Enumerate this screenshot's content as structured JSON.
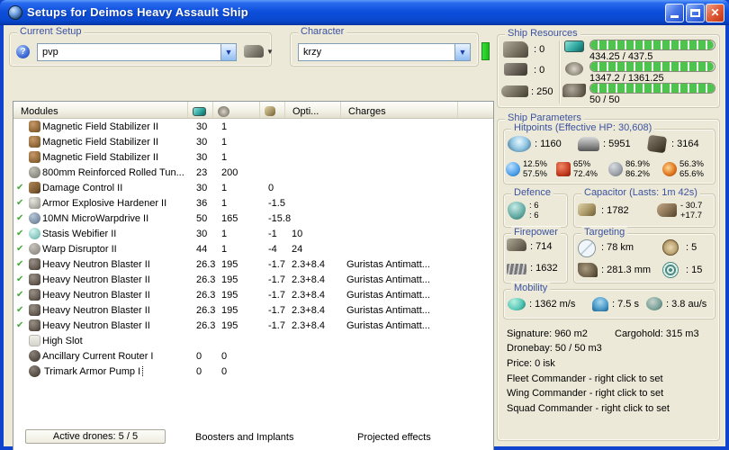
{
  "window": {
    "title": "Setups for Deimos Heavy Assault Ship"
  },
  "colors": {
    "titlebar_blue": "#0D4FDC",
    "body_beige": "#ECE9D8",
    "active_check_green": "#44A838",
    "resource_bar_green": "#4EC44E",
    "character_indicator_green": "#2FD52F",
    "group_label_blue": "#3B52A0"
  },
  "header": {
    "current_setup": {
      "label": "Current Setup",
      "value": "pvp"
    },
    "character": {
      "label": "Character",
      "value": "krzy"
    }
  },
  "modules_table": {
    "active_glyph": "✔",
    "columns": {
      "modules": "Modules",
      "opti": "Opti...",
      "charges": "Charges"
    },
    "rows": [
      {
        "active": false,
        "icon": "magstab",
        "name": "Magnetic Field Stabilizer II",
        "cpu": "30",
        "pg": "1",
        "cap": "",
        "opti": "",
        "charges": ""
      },
      {
        "active": false,
        "icon": "magstab",
        "name": "Magnetic Field Stabilizer II",
        "cpu": "30",
        "pg": "1",
        "cap": "",
        "opti": "",
        "charges": ""
      },
      {
        "active": false,
        "icon": "magstab",
        "name": "Magnetic Field Stabilizer II",
        "cpu": "30",
        "pg": "1",
        "cap": "",
        "opti": "",
        "charges": ""
      },
      {
        "active": false,
        "icon": "plate",
        "name": "800mm Reinforced Rolled Tun...",
        "cpu": "23",
        "pg": "200",
        "cap": "",
        "opti": "",
        "charges": ""
      },
      {
        "active": true,
        "icon": "damage-control",
        "name": "Damage Control II",
        "cpu": "30",
        "pg": "1",
        "cap": "0",
        "opti": "",
        "charges": ""
      },
      {
        "active": true,
        "icon": "hardener",
        "name": "Armor Explosive Hardener II",
        "cpu": "36",
        "pg": "1",
        "cap": "-1.5",
        "opti": "",
        "charges": ""
      },
      {
        "active": true,
        "icon": "mwd",
        "name": "10MN MicroWarpdrive II",
        "cpu": "50",
        "pg": "165",
        "cap": "-15.8",
        "opti": "",
        "charges": ""
      },
      {
        "active": true,
        "icon": "web",
        "name": "Stasis Webifier II",
        "cpu": "30",
        "pg": "1",
        "cap": "-1",
        "opti": "10",
        "charges": ""
      },
      {
        "active": true,
        "icon": "disruptor",
        "name": "Warp Disruptor II",
        "cpu": "44",
        "pg": "1",
        "cap": "-4",
        "opti": "24",
        "charges": ""
      },
      {
        "active": true,
        "icon": "blaster",
        "name": "Heavy Neutron Blaster II",
        "cpu": "26.3",
        "pg": "195",
        "cap": "-1.7",
        "opti": "2.3+8.4",
        "charges": "Guristas Antimatt..."
      },
      {
        "active": true,
        "icon": "blaster",
        "name": "Heavy Neutron Blaster II",
        "cpu": "26.3",
        "pg": "195",
        "cap": "-1.7",
        "opti": "2.3+8.4",
        "charges": "Guristas Antimatt..."
      },
      {
        "active": true,
        "icon": "blaster",
        "name": "Heavy Neutron Blaster II",
        "cpu": "26.3",
        "pg": "195",
        "cap": "-1.7",
        "opti": "2.3+8.4",
        "charges": "Guristas Antimatt..."
      },
      {
        "active": true,
        "icon": "blaster",
        "name": "Heavy Neutron Blaster II",
        "cpu": "26.3",
        "pg": "195",
        "cap": "-1.7",
        "opti": "2.3+8.4",
        "charges": "Guristas Antimatt..."
      },
      {
        "active": true,
        "icon": "blaster",
        "name": "Heavy Neutron Blaster II",
        "cpu": "26.3",
        "pg": "195",
        "cap": "-1.7",
        "opti": "2.3+8.4",
        "charges": "Guristas Antimatt..."
      },
      {
        "active": false,
        "icon": "highslot",
        "name": "High Slot",
        "cpu": "",
        "pg": "",
        "cap": "",
        "opti": "",
        "charges": ""
      },
      {
        "active": false,
        "icon": "rig",
        "name": "Ancillary Current Router I",
        "cpu": "0",
        "pg": "0",
        "cap": "",
        "opti": "",
        "charges": ""
      },
      {
        "active": false,
        "icon": "rig",
        "name": "Trimark Armor Pump I",
        "cpu": "0",
        "pg": "0",
        "cap": "",
        "opti": "",
        "charges": "",
        "focused": true
      }
    ]
  },
  "footer": {
    "active_drones": "Active drones: 5 / 5",
    "boosters_implants": "Boosters and Implants",
    "projected_effects": "Projected effects"
  },
  "ship_resources": {
    "label": "Ship Resources",
    "turret_slots": ": 0",
    "launcher_slots": ": 0",
    "calibration": ": 250",
    "cpu_text": "434.25 / 437.5",
    "powergrid_text": "1347.2 / 1361.25",
    "drones_text": "50 / 50"
  },
  "ship_parameters": {
    "label": "Ship Parameters",
    "hitpoints": {
      "label": "Hitpoints (Effective HP: 30,608)",
      "shield": ": 1160",
      "armor": ": 5951",
      "hull": ": 3164",
      "resists": {
        "em": [
          "12.5%",
          "57.5%"
        ],
        "explosive": [
          "65%",
          "72.4%"
        ],
        "kinetic": [
          "86.9%",
          "86.2%"
        ],
        "thermal": [
          "56.3%",
          "65.6%"
        ]
      }
    },
    "defence": {
      "label": "Defence",
      "values": [
        ": 6",
        ": 6"
      ]
    },
    "capacitor": {
      "label": "Capacitor (Lasts: 1m 42s)",
      "amount": ": 1782",
      "delta": [
        "- 30.7",
        "+17.7"
      ]
    },
    "firepower": {
      "label": "Firepower",
      "turret_dps": ": 714",
      "volley": ": 1632"
    },
    "targeting": {
      "label": "Targeting",
      "range": ": 78 km",
      "scan_res": ": 281.3 mm",
      "max_targets": ": 5",
      "sensor_strength": ": 15"
    },
    "mobility": {
      "label": "Mobility",
      "speed": ": 1362 m/s",
      "align_time": ": 7.5 s",
      "warp_speed": ": 3.8 au/s"
    },
    "info": {
      "signature": "Signature: 960 m2",
      "cargohold": "Cargohold: 315 m3",
      "dronebay": "Dronebay: 50 / 50 m3",
      "price": "Price: 0 isk",
      "fleet": "Fleet Commander - right click to set",
      "wing": "Wing Commander - right click to set",
      "squad": "Squad Commander - right click to set"
    }
  }
}
